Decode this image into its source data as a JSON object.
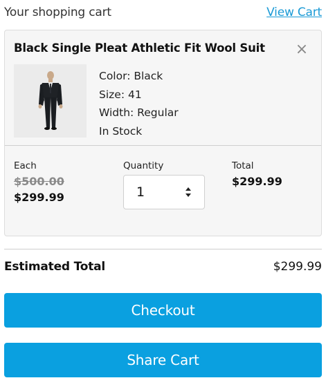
{
  "header": {
    "title": "Your shopping cart",
    "view_cart_link": "View Cart"
  },
  "cart_item": {
    "name": "Black Single Pleat Athletic Fit Wool Suit",
    "image_icon": "suit-product-photo",
    "close_icon": "×",
    "attributes": [
      "Color: Black",
      "Size: 41",
      "Width: Regular",
      "In Stock"
    ],
    "each_label": "Each",
    "original_price": "$500.00",
    "sale_price": "$299.99",
    "quantity_label": "Quantity",
    "quantity_value": "1",
    "total_label": "Total",
    "total_value": "$299.99"
  },
  "summary": {
    "estimated_total_label": "Estimated Total",
    "estimated_total_value": "$299.99"
  },
  "buttons": {
    "checkout": "Checkout",
    "share_cart": "Share Cart"
  },
  "colors": {
    "accent": "#0aa0e0",
    "link": "#1a9ad6",
    "card_bg": "#f6f6f6"
  }
}
